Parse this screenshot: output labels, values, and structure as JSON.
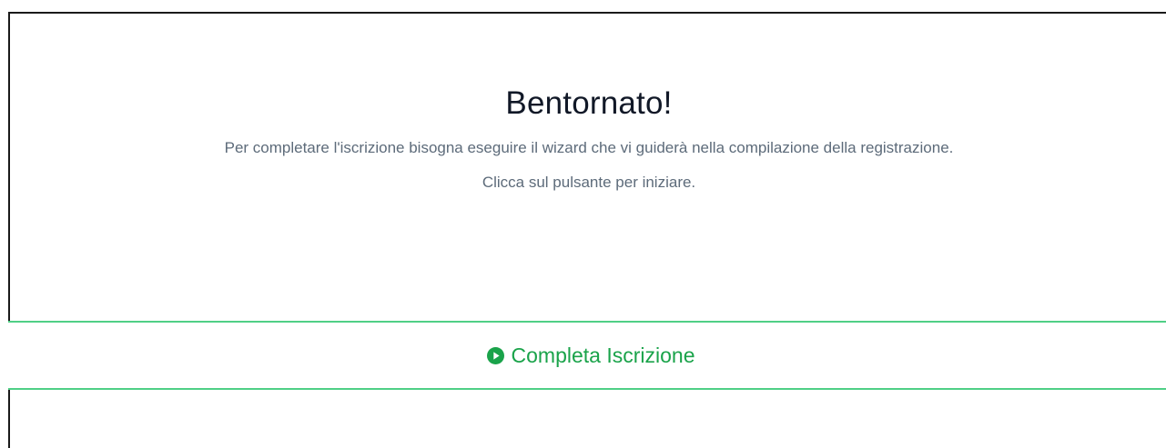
{
  "welcome": {
    "title": "Bentornato!",
    "line1": "Per completare l'iscrizione bisogna eseguire il wizard che vi guiderà nella compilazione della registrazione.",
    "line2": "Clicca sul pulsante per iniziare."
  },
  "cta": {
    "label": "Completa Iscrizione",
    "icon": "play-circle-icon",
    "color": "#1aa34a",
    "border_color": "#4fcf86"
  }
}
